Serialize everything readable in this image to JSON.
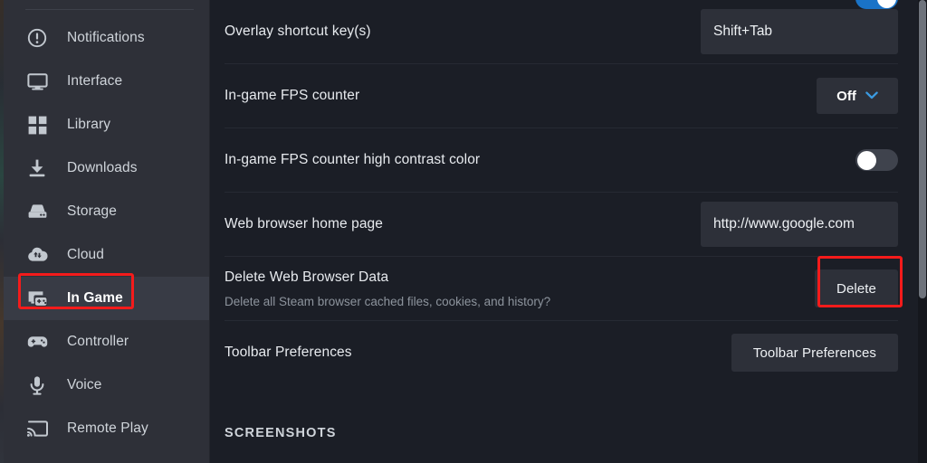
{
  "sidebar": {
    "items": [
      {
        "label": "Notifications",
        "icon": "notification-bell-icon",
        "active": false
      },
      {
        "label": "Interface",
        "icon": "monitor-icon",
        "active": false
      },
      {
        "label": "Library",
        "icon": "grid-icon",
        "active": false
      },
      {
        "label": "Downloads",
        "icon": "download-icon",
        "active": false
      },
      {
        "label": "Storage",
        "icon": "hard-drive-icon",
        "active": false
      },
      {
        "label": "Cloud",
        "icon": "cloud-sync-icon",
        "active": false
      },
      {
        "label": "In Game",
        "icon": "in-game-overlay-icon",
        "active": true
      },
      {
        "label": "Controller",
        "icon": "gamepad-icon",
        "active": false
      },
      {
        "label": "Voice",
        "icon": "microphone-icon",
        "active": false
      },
      {
        "label": "Remote Play",
        "icon": "cast-screen-icon",
        "active": false
      }
    ]
  },
  "settings": {
    "rows": [
      {
        "label": "Overlay shortcut key(s)",
        "sub": "",
        "control": "textfield",
        "value": "Shift+Tab"
      },
      {
        "label": "In-game FPS counter",
        "sub": "",
        "control": "dropdown",
        "value": "Off"
      },
      {
        "label": "In-game FPS counter high contrast color",
        "sub": "",
        "control": "toggle",
        "value": "off"
      },
      {
        "label": "Web browser home page",
        "sub": "",
        "control": "textfield",
        "value": "http://www.google.com"
      },
      {
        "label": "Delete Web Browser Data",
        "sub": "Delete all Steam browser cached files, cookies, and history?",
        "control": "button",
        "value": "Delete"
      },
      {
        "label": "Toolbar Preferences",
        "sub": "",
        "control": "button",
        "value": "Toolbar Preferences"
      }
    ],
    "section_heading": "SCREENSHOTS",
    "top_partial_toggle": "on"
  },
  "annotations": {
    "highlight_color": "#f41b1b",
    "boxes": [
      {
        "name": "in-game-sidebar-highlight"
      },
      {
        "name": "delete-button-highlight"
      }
    ]
  },
  "colors": {
    "sidebar_bg": "#2e3038",
    "content_bg": "#1b1e26",
    "field_bg": "#2d3039",
    "accent_blue": "#1a73c7",
    "text_primary": "#e7eaee",
    "text_secondary": "#8d949d"
  },
  "scrollbar": {
    "position": "right",
    "thumb_label": "vertical-scroll-thumb"
  }
}
